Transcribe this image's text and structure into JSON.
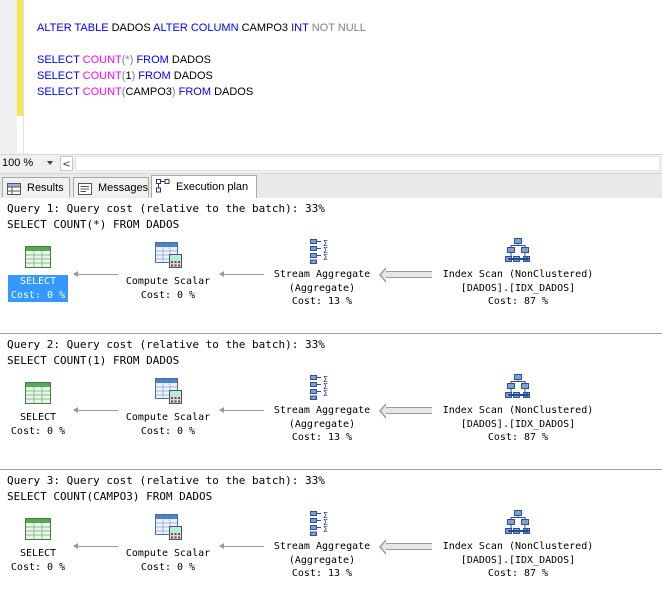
{
  "editor": {
    "lines": [
      [
        {
          "t": "ALTER TABLE",
          "c": "kw"
        },
        {
          "t": " DADOS ",
          "c": ""
        },
        {
          "t": "ALTER COLUMN",
          "c": "kw"
        },
        {
          "t": " CAMPO3 ",
          "c": ""
        },
        {
          "t": "INT",
          "c": "kw"
        },
        {
          "t": " ",
          "c": ""
        },
        {
          "t": "NOT NULL",
          "c": "gr"
        }
      ],
      [],
      [
        {
          "t": "SELECT",
          "c": "kw"
        },
        {
          "t": " ",
          "c": ""
        },
        {
          "t": "COUNT",
          "c": "fn"
        },
        {
          "t": "(*)",
          "c": "gr"
        },
        {
          "t": " ",
          "c": ""
        },
        {
          "t": "FROM",
          "c": "kw"
        },
        {
          "t": " DADOS",
          "c": ""
        }
      ],
      [
        {
          "t": "SELECT",
          "c": "kw"
        },
        {
          "t": " ",
          "c": ""
        },
        {
          "t": "COUNT",
          "c": "fn"
        },
        {
          "t": "(",
          "c": "gr"
        },
        {
          "t": "1",
          "c": ""
        },
        {
          "t": ")",
          "c": "gr"
        },
        {
          "t": " ",
          "c": ""
        },
        {
          "t": "FROM",
          "c": "kw"
        },
        {
          "t": " DADOS",
          "c": ""
        }
      ],
      [
        {
          "t": "SELECT",
          "c": "kw"
        },
        {
          "t": " ",
          "c": ""
        },
        {
          "t": "COUNT",
          "c": "fn"
        },
        {
          "t": "(",
          "c": "gr"
        },
        {
          "t": "CAMPO3",
          "c": ""
        },
        {
          "t": ")",
          "c": "gr"
        },
        {
          "t": " ",
          "c": ""
        },
        {
          "t": "FROM",
          "c": "kw"
        },
        {
          "t": " DADOS",
          "c": ""
        }
      ]
    ]
  },
  "status": {
    "zoom": "100 %",
    "scroll_left": "<"
  },
  "tabs": [
    {
      "label": "Results",
      "icon": "grid-icon"
    },
    {
      "label": "Messages",
      "icon": "messages-icon"
    },
    {
      "label": "Execution plan",
      "icon": "execution-plan-icon"
    }
  ],
  "queries": [
    {
      "title": "Query 1: Query cost (relative to the batch): 33%",
      "sql": "SELECT COUNT(*) FROM DADOS",
      "nodes": {
        "select": {
          "name": "SELECT",
          "cost": "Cost: 0 %",
          "selected": true
        },
        "compute": {
          "name": "Compute Scalar",
          "cost": "Cost: 0 %"
        },
        "stream": {
          "name": "Stream Aggregate",
          "sub": "(Aggregate)",
          "cost": "Cost: 13 %"
        },
        "scan": {
          "name": "Index Scan (NonClustered)",
          "sub": "[DADOS].[IDX_DADOS]",
          "cost": "Cost: 87 %"
        }
      }
    },
    {
      "title": "Query 2: Query cost (relative to the batch): 33%",
      "sql": "SELECT COUNT(1) FROM DADOS",
      "nodes": {
        "select": {
          "name": "SELECT",
          "cost": "Cost: 0 %",
          "selected": false
        },
        "compute": {
          "name": "Compute Scalar",
          "cost": "Cost: 0 %"
        },
        "stream": {
          "name": "Stream Aggregate",
          "sub": "(Aggregate)",
          "cost": "Cost: 13 %"
        },
        "scan": {
          "name": "Index Scan (NonClustered)",
          "sub": "[DADOS].[IDX_DADOS]",
          "cost": "Cost: 87 %"
        }
      }
    },
    {
      "title": "Query 3: Query cost (relative to the batch): 33%",
      "sql": "SELECT COUNT(CAMPO3) FROM DADOS",
      "nodes": {
        "select": {
          "name": "SELECT",
          "cost": "Cost: 0 %",
          "selected": false
        },
        "compute": {
          "name": "Compute Scalar",
          "cost": "Cost: 0 %"
        },
        "stream": {
          "name": "Stream Aggregate",
          "sub": "(Aggregate)",
          "cost": "Cost: 13 %"
        },
        "scan": {
          "name": "Index Scan (NonClustered)",
          "sub": "[DADOS].[IDX_DADOS]",
          "cost": "Cost: 87 %"
        }
      }
    }
  ]
}
